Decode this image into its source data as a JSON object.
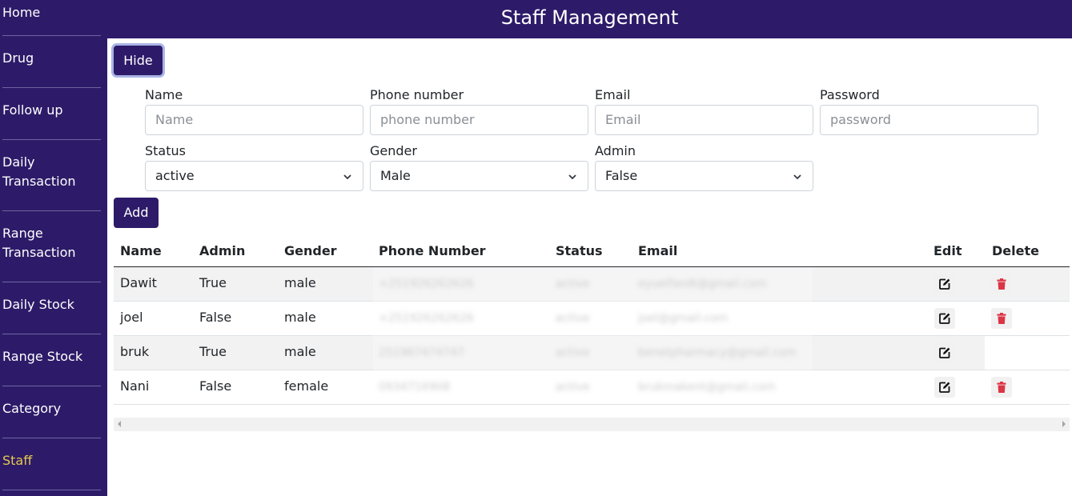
{
  "sidebar": {
    "items": [
      {
        "label": "Home"
      },
      {
        "label": "Drug"
      },
      {
        "label": "Follow up"
      },
      {
        "label": "Daily Transaction"
      },
      {
        "label": "Range Transaction"
      },
      {
        "label": "Daily Stock"
      },
      {
        "label": "Range Stock"
      },
      {
        "label": "Category"
      },
      {
        "label": "Staff",
        "active": true
      }
    ]
  },
  "header": {
    "title": "Staff Management"
  },
  "buttons": {
    "hide": "Hide",
    "add": "Add"
  },
  "form": {
    "name": {
      "label": "Name",
      "placeholder": "Name"
    },
    "phone": {
      "label": "Phone number",
      "placeholder": "phone number"
    },
    "email": {
      "label": "Email",
      "placeholder": "Email"
    },
    "password": {
      "label": "Password",
      "placeholder": "password"
    },
    "status": {
      "label": "Status",
      "value": "active"
    },
    "gender": {
      "label": "Gender",
      "value": "Male"
    },
    "admin": {
      "label": "Admin",
      "value": "False"
    }
  },
  "table": {
    "columns": [
      "Name",
      "Admin",
      "Gender",
      "Phone Number",
      "Status",
      "Email",
      "Edit",
      "Delete"
    ],
    "rows": [
      {
        "name": "Dawit",
        "admin": "True",
        "gender": "male",
        "phone": "+251926262626",
        "status": "active",
        "email": "eyuelfani6@gmail.com",
        "deletable": true
      },
      {
        "name": "joel",
        "admin": "False",
        "gender": "male",
        "phone": "+251926262626",
        "status": "active",
        "email": "joel@gmail.com",
        "deletable": true
      },
      {
        "name": "bruk",
        "admin": "True",
        "gender": "male",
        "phone": "251967474747",
        "status": "active",
        "email": "benetpharmacy@gmail.com",
        "deletable": false
      },
      {
        "name": "Nani",
        "admin": "False",
        "gender": "female",
        "phone": "0934716908",
        "status": "active",
        "email": "brukmakent@gmail.com",
        "deletable": true
      }
    ]
  },
  "colors": {
    "brand": "#2d1b69",
    "active_nav": "#e6c84a",
    "danger": "#dc3545"
  },
  "icons": {
    "edit": "edit-icon",
    "delete": "trash-icon",
    "select": "chevron-down-icon"
  }
}
